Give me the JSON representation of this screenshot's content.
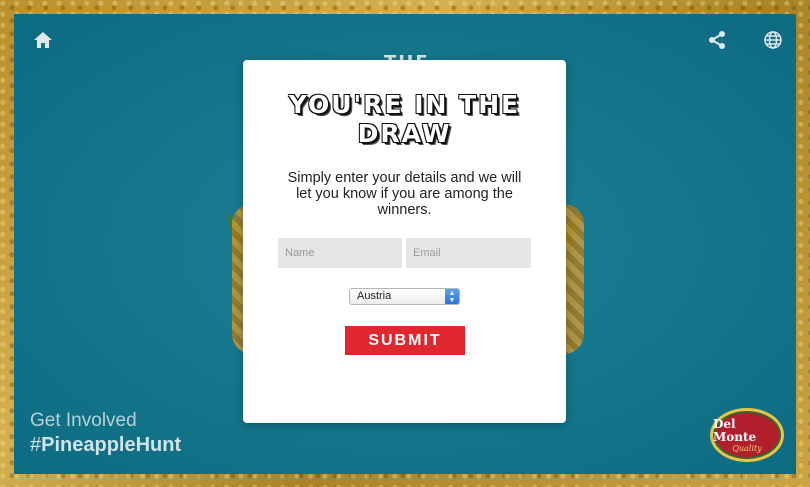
{
  "icons": {
    "home": "home-icon",
    "share": "share-icon",
    "globe": "globe-icon"
  },
  "background": {
    "partial_word": "THE"
  },
  "modal": {
    "title": "YOU'RE IN THE DRAW",
    "body": "Simply enter your details and we will let you know if you are among the winners.",
    "name_placeholder": "Name",
    "email_placeholder": "Email",
    "country_value": "Austria",
    "submit_label": "SUBMIT"
  },
  "footer": {
    "line1": "Get Involved",
    "hash": "#",
    "hashtag": "PineappleHunt"
  },
  "logo": {
    "brand": "Del Monte",
    "sub": "Quality"
  },
  "colors": {
    "teal": "#0f7a92",
    "submit": "#e0262e",
    "brand_red": "#b11f2c"
  }
}
